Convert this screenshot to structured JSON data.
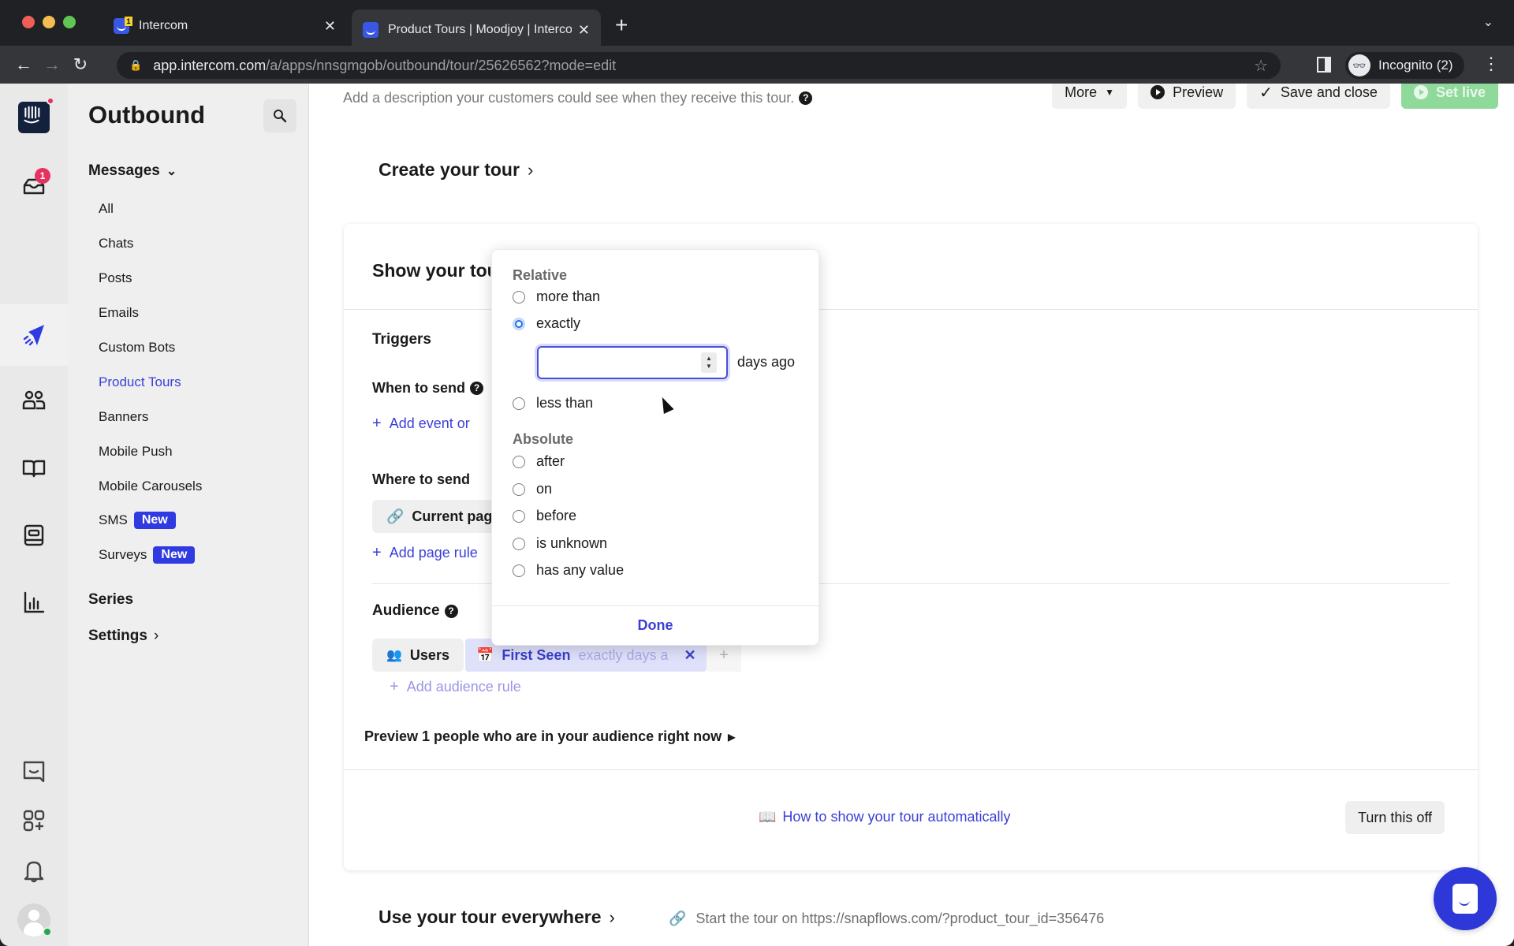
{
  "browser": {
    "tabs": [
      {
        "title": "Intercom",
        "badge": "1",
        "active": false
      },
      {
        "title": "Product Tours | Moodjoy | Intercom",
        "active": true
      }
    ],
    "url_host": "app.intercom.com",
    "url_path": "/a/apps/nnsgmgob/outbound/tour/25626562?mode=edit",
    "profile_label": "Incognito (2)"
  },
  "rail": {
    "inbox_badge": "1",
    "items": [
      "intercom-logo",
      "inbox",
      "outbound",
      "contacts",
      "articles",
      "reports-inbox",
      "reports"
    ],
    "bottom_items": [
      "messenger",
      "app-store",
      "notifications",
      "user-avatar"
    ]
  },
  "nav": {
    "title": "Outbound",
    "messages_label": "Messages",
    "items": [
      {
        "label": "All"
      },
      {
        "label": "Chats"
      },
      {
        "label": "Posts"
      },
      {
        "label": "Emails"
      },
      {
        "label": "Custom Bots"
      },
      {
        "label": "Product Tours",
        "active": true
      },
      {
        "label": "Banners"
      },
      {
        "label": "Mobile Push"
      },
      {
        "label": "Mobile Carousels"
      },
      {
        "label": "SMS",
        "badge": "New"
      },
      {
        "label": "Surveys",
        "badge": "New"
      }
    ],
    "series_label": "Series",
    "settings_label": "Settings"
  },
  "header": {
    "description": "Add a description your customers could see when they receive this tour.",
    "more_label": "More",
    "preview_label": "Preview",
    "save_close_label": "Save and close",
    "set_live_label": "Set live"
  },
  "sections": {
    "create_tour": "Create your tour",
    "show_tour": "Show your tour automatically",
    "triggers": "Triggers",
    "when_to_send": "When to send",
    "add_event": "Add event or",
    "where_to_send": "Where to send",
    "current_page": "Current page",
    "add_page_rule": "Add page rule",
    "audience": "Audience",
    "users_label": "Users",
    "chip_attr": "First Seen",
    "chip_rest": "exactly days a",
    "add_audience_rule": "Add audience rule",
    "preview_audience": "Preview 1 people who are in your audience right now",
    "help_link": "How to show your tour automatically",
    "turn_off": "Turn this off",
    "everywhere": "Use your tour everywhere",
    "everywhere_note": "Start the tour on https://snapflows.com/?product_tour_id=356476"
  },
  "popover": {
    "relative_label": "Relative",
    "relative_options": [
      {
        "label": "more than",
        "checked": false
      },
      {
        "label": "exactly",
        "checked": true
      },
      {
        "label": "less than",
        "checked": false
      }
    ],
    "days_value": "",
    "days_suffix": "days ago",
    "absolute_label": "Absolute",
    "absolute_options": [
      {
        "label": "after",
        "checked": false
      },
      {
        "label": "on",
        "checked": false
      },
      {
        "label": "before",
        "checked": false
      },
      {
        "label": "is unknown",
        "checked": false
      },
      {
        "label": "has any value",
        "checked": false
      }
    ],
    "done_label": "Done"
  },
  "colors": {
    "accent": "#3b3fd8",
    "badge_red": "#e5325e",
    "new_badge": "#2f3be0",
    "set_live_green": "#8fd99b",
    "chip_bg": "#dfe1fb",
    "radio_checked": "#1d6ef2"
  }
}
